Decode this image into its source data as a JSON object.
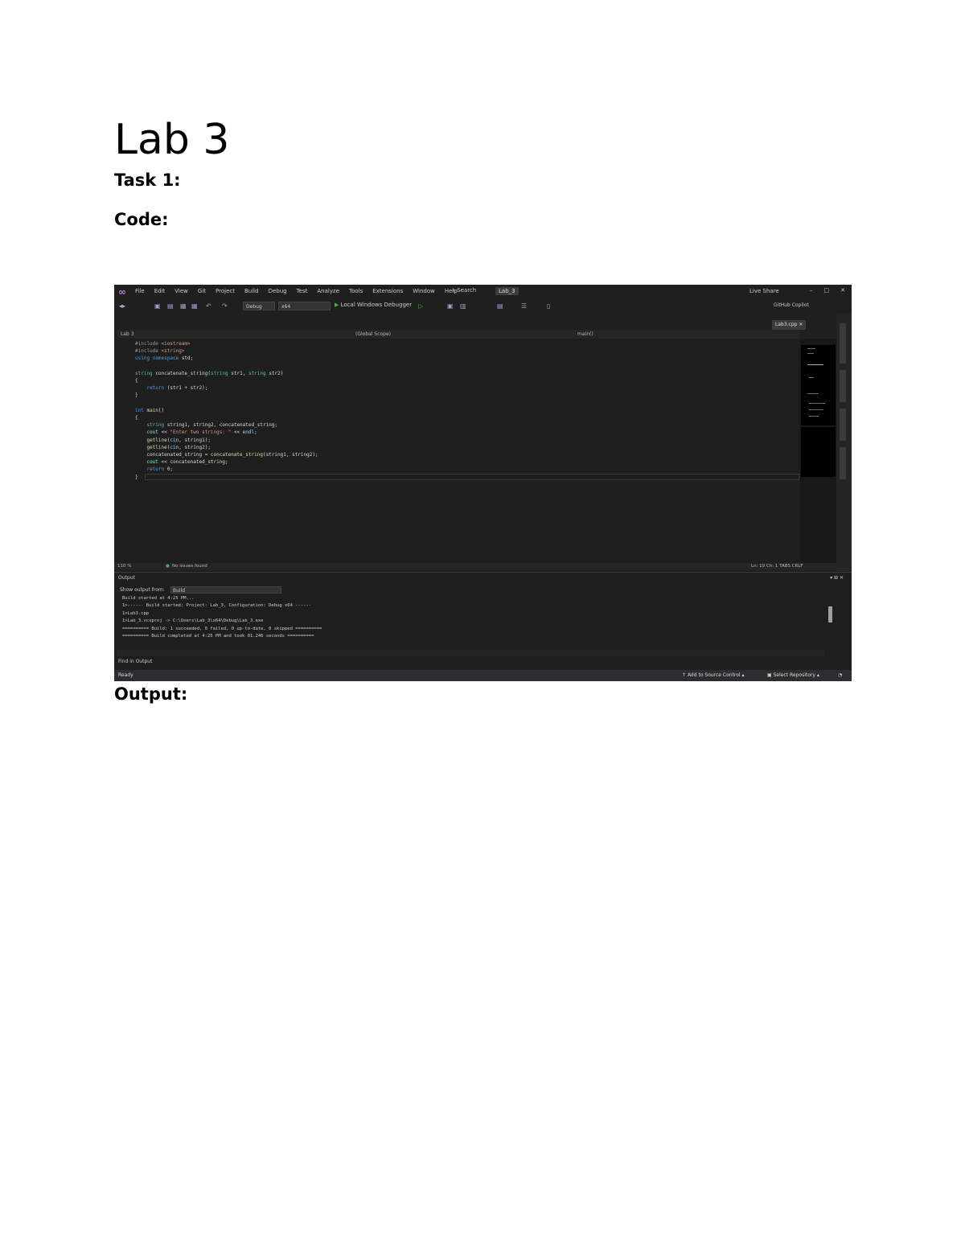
{
  "document": {
    "title": "Lab 3",
    "task_heading": "Task 1:",
    "code_heading": "Code:",
    "output_heading": "Output:"
  },
  "ide": {
    "menu": [
      "File",
      "Edit",
      "View",
      "Git",
      "Project",
      "Build",
      "Debug",
      "Test",
      "Analyze",
      "Tools",
      "Extensions",
      "Window",
      "Help"
    ],
    "search_label": "Search",
    "solution_name": "Lab_3",
    "live_share": "Live Share",
    "config": "Debug",
    "platform": "x64",
    "run_label": "Local Windows Debugger",
    "copilot": "GitHub Copilot",
    "file_tab": "Lab3.cpp",
    "nav_project": "Lab 3",
    "nav_scope": "(Global Scope)",
    "nav_function": "main()",
    "code_lines": [
      "#include <iostream>",
      "#include <string>",
      "using namespace std;",
      "",
      "string concatenate_string(string str1, string str2)",
      "{",
      "    return (str1 + str2);",
      "}",
      "",
      "int main()",
      "{",
      "    string string1, string2, concatenated_string;",
      "    cout << \"Enter two strings: \" << endl;",
      "    getline(cin, string1);",
      "    getline(cin, string2);",
      "    concatenated_string = concatenate_string(string1, string2);",
      "    cout << concatenated_string;",
      "    return 0;",
      "}"
    ],
    "zoom": "110 %",
    "issues": "No issues found",
    "position": "Ln: 19   Ch: 1   TABS   CRLF",
    "output_title": "Output",
    "output_show_label": "Show output from:",
    "output_source": "Build",
    "output_lines": [
      "Build started at 4:25 PM...",
      "1>------ Build started: Project: Lab_3, Configuration: Debug x64 ------",
      "1>Lab3.cpp",
      "1>Lab_3.vcxproj -> C:\\Users\\Lab_3\\x64\\Debug\\Lab_3.exe",
      "========== Build: 1 succeeded, 0 failed, 0 up-to-date, 0 skipped ==========",
      "========== Build completed at 4:25 PM and took 01.246 seconds =========="
    ],
    "find_output": "Find in Output",
    "status_ready": "Ready",
    "add_source_control": "Add to Source Control",
    "select_repository": "Select Repository"
  }
}
